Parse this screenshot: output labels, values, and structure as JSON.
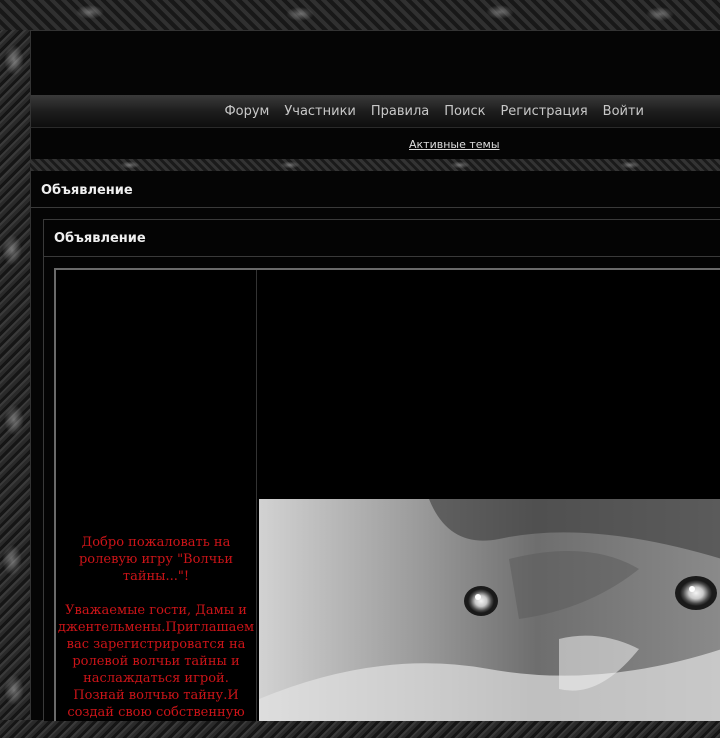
{
  "nav": {
    "items": [
      "Форум",
      "Участники",
      "Правила",
      "Поиск",
      "Регистрация",
      "Войти"
    ]
  },
  "subnav": {
    "active_topics": "Активные темы"
  },
  "main": {
    "title": "Объявление"
  },
  "panel": {
    "title": "Объявление"
  },
  "announcement": {
    "greeting": "Добро пожаловать на ролевую игру \"Волчьи тайны...\"!",
    "invitation": "Уважаемые гости, Дамы и джентельмены.Приглашаем вас зарегистрироватся на ролевой волчьи тайны и наслаждаться игрой. Познай волчью тайну.И создай свою собственную"
  },
  "colors": {
    "announcement_text": "#cc1418",
    "background": "#000000"
  },
  "icons": {
    "banner": "wolf-face-image"
  }
}
